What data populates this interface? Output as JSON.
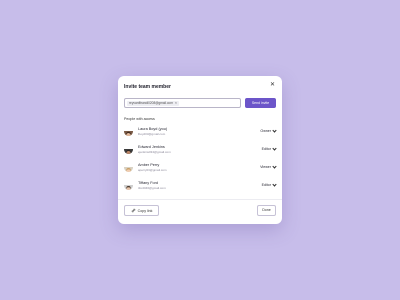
{
  "colors": {
    "background": "#c7bdea",
    "accent": "#6c55c9",
    "modal": "#ffffff"
  },
  "modal": {
    "title": "Invite team member",
    "close_icon": "close-icon"
  },
  "invite": {
    "chip_email": "reyvanfitrandi0208@gmail.com",
    "chip_remove": "×",
    "send_label": "Send invite"
  },
  "people": {
    "section_label": "People with access",
    "list": [
      {
        "name": "Laura Boyd (you)",
        "email": "lboyd03@gmail.com",
        "role": "Owner"
      },
      {
        "name": "Edward Jenkins",
        "email": "ejenkins034@gmail.com",
        "role": "Editor"
      },
      {
        "name": "Amber Perry",
        "email": "aperry03@gmail.com",
        "role": "Viewer"
      },
      {
        "name": "Tiffany Ford",
        "email": "tford046@gmail.com",
        "role": "Editor"
      }
    ]
  },
  "footer": {
    "copy_label": "Copy link",
    "copy_icon": "link-icon",
    "done_label": "Done"
  }
}
